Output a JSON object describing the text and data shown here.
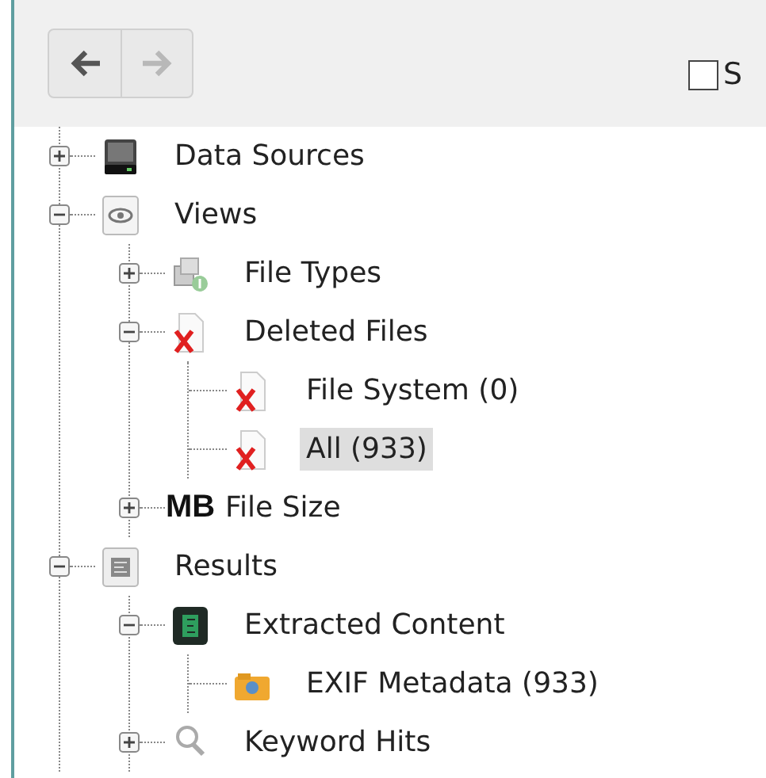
{
  "toolbar": {
    "back": {
      "disabled": false
    },
    "forward": {
      "disabled": true
    },
    "checkbox": {
      "label": "S",
      "checked": false
    }
  },
  "tree": [
    {
      "label": "Data Sources",
      "kind": "disk",
      "expanded": false,
      "selected": false
    },
    {
      "label": "Views",
      "kind": "eye",
      "expanded": true,
      "selected": false,
      "children": [
        {
          "label": "File Types",
          "kind": "filetypes",
          "expanded": false,
          "selected": false
        },
        {
          "label": "Deleted Files",
          "kind": "deleted",
          "expanded": true,
          "selected": false,
          "children": [
            {
              "label": "File System (0)",
              "kind": "deleted",
              "selected": false
            },
            {
              "label": "All (933)",
              "kind": "deleted",
              "selected": true
            }
          ]
        },
        {
          "label": "File Size",
          "unit": "MB",
          "kind": "unit",
          "expanded": false,
          "selected": false
        }
      ]
    },
    {
      "label": "Results",
      "kind": "results",
      "expanded": true,
      "selected": false,
      "children": [
        {
          "label": "Extracted Content",
          "kind": "extracted",
          "expanded": true,
          "selected": false,
          "children": [
            {
              "label": "EXIF Metadata (933)",
              "kind": "exif",
              "selected": false
            }
          ]
        },
        {
          "label": "Keyword Hits",
          "kind": "search",
          "expanded": false,
          "selected": false
        }
      ]
    }
  ]
}
